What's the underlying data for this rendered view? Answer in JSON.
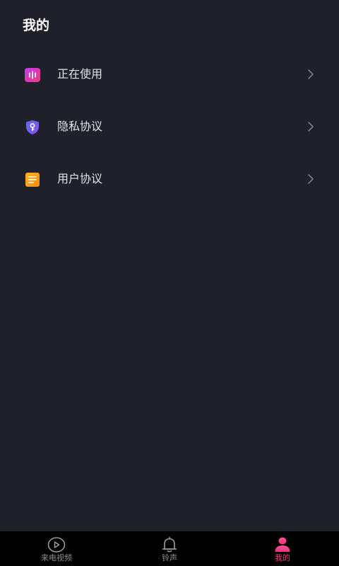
{
  "header": {
    "title": "我的"
  },
  "menu": {
    "items": [
      {
        "label": "正在使用",
        "icon": "audio-bars-icon",
        "color": "#e83aa0"
      },
      {
        "label": "隐私协议",
        "icon": "shield-key-icon",
        "color": "#6b5cf0"
      },
      {
        "label": "用户协议",
        "icon": "document-list-icon",
        "color": "#f7a21b"
      }
    ]
  },
  "tabbar": {
    "tabs": [
      {
        "label": "来电视频",
        "icon": "play-circle-icon",
        "active": false
      },
      {
        "label": "铃声",
        "icon": "bell-icon",
        "active": false
      },
      {
        "label": "我的",
        "icon": "user-icon",
        "active": true
      }
    ],
    "active_color": "#ef3f7d",
    "inactive_color": "#8c8c94"
  },
  "colors": {
    "background": "#20202a",
    "tabbar_background": "#000000"
  }
}
